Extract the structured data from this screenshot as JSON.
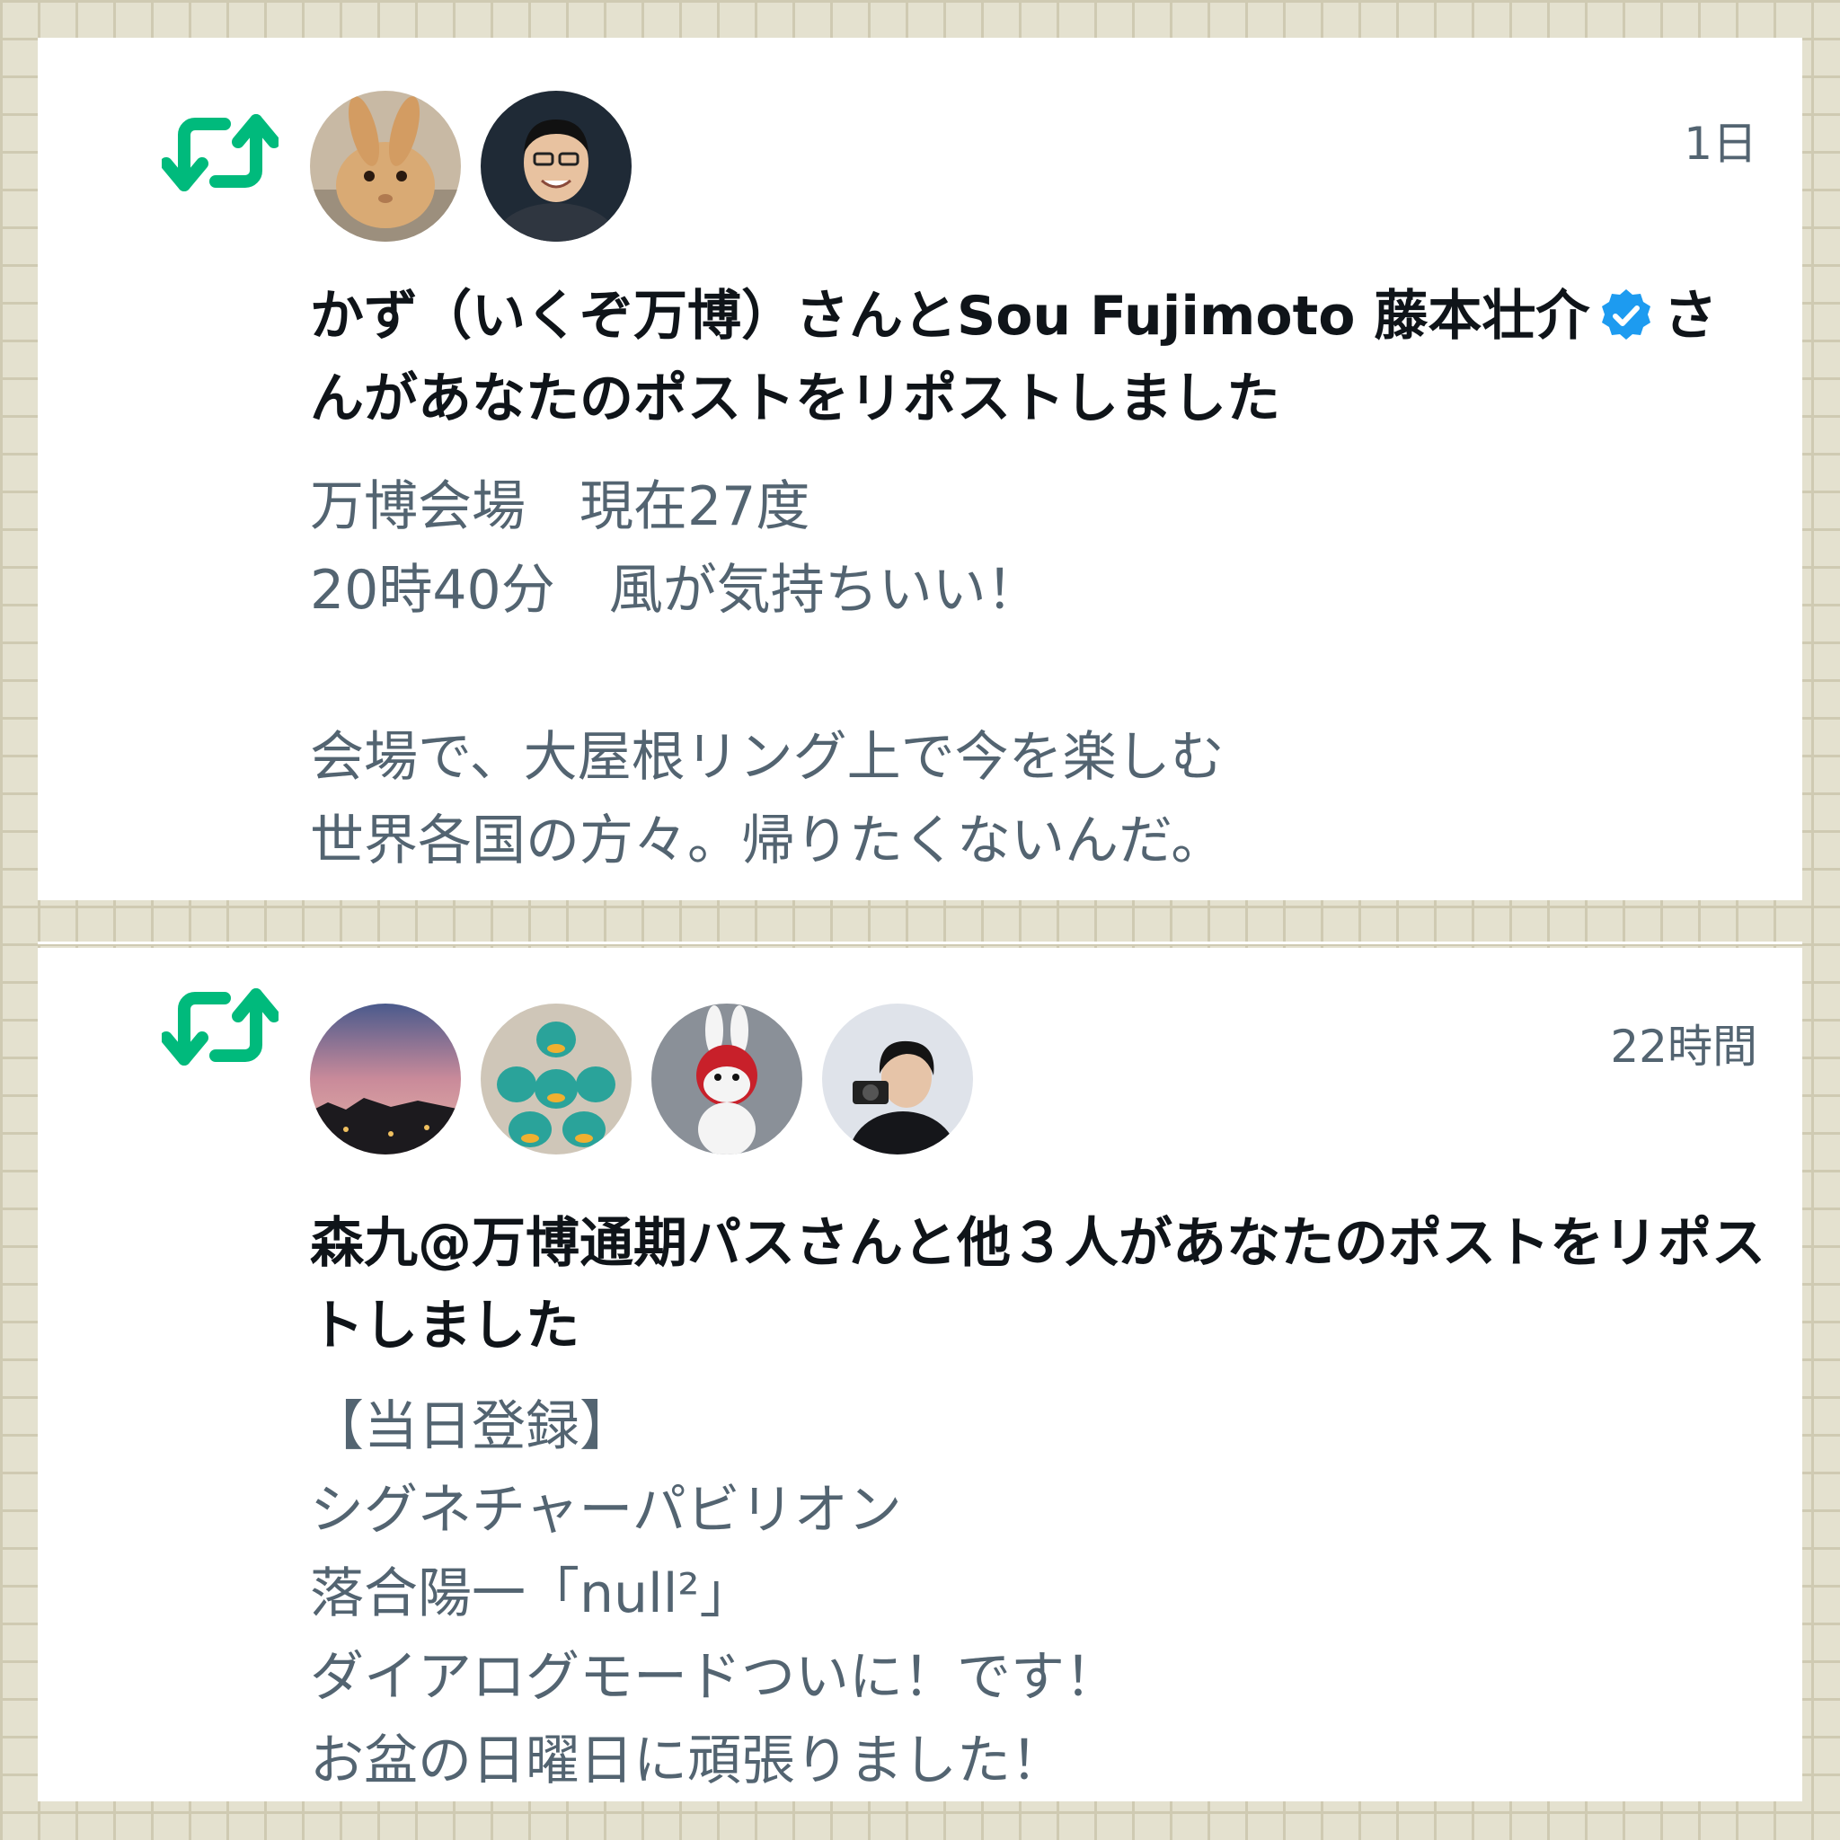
{
  "notifications": [
    {
      "time": "1日",
      "avatars": [
        "rabbit-avatar",
        "smiling-man-avatar"
      ],
      "headline_prefix": "かず（いくぞ万博）さんとSou Fujimoto 藤本壮介",
      "headline_suffix": "さんがあなたのポストをリポストしました",
      "verified": true,
      "body_lines": [
        "万博会場　現在27度",
        "20時40分　風が気持ちいい！",
        "",
        "会場で、大屋根リング上で今を楽しむ",
        "世界各国の方々。帰りたくないんだ。"
      ]
    },
    {
      "time": "22時間",
      "avatars": [
        "sunset-sky-avatar",
        "plush-ducks-avatar",
        "mascot-figure-avatar",
        "man-with-camera-avatar"
      ],
      "headline_prefix": "森九@万博通期パスさんと他３人があなたのポストをリポストしました",
      "headline_suffix": "",
      "verified": false,
      "body_lines": [
        "【当日登録】",
        "シグネチャーパビリオン",
        "落合陽一「null²」",
        "ダイアログモードついに！です！",
        "お盆の日曜日に頑張りました！"
      ]
    }
  ],
  "colors": {
    "retweet": "#00ba7c",
    "verified": "#1d9bf0",
    "headline": "#0f1419",
    "body": "#536471"
  }
}
